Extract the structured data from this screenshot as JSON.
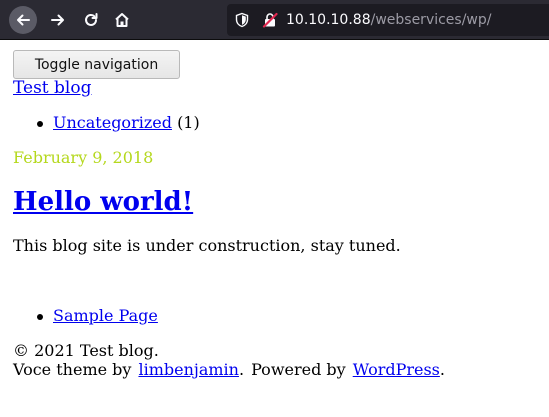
{
  "browser": {
    "url_host": "10.10.10.88",
    "url_path": "/webservices/wp/"
  },
  "page": {
    "toggle_label": "Toggle navigation",
    "site_title": "Test blog",
    "categories": [
      {
        "label": "Uncategorized",
        "count": "(1)"
      }
    ],
    "post": {
      "date": "February 9, 2018",
      "title": "Hello world!",
      "body": "This blog site is under construction, stay tuned."
    },
    "pages": [
      {
        "label": "Sample Page"
      }
    ],
    "footer": {
      "copyright": "© 2021 Test blog.",
      "theme_prefix": "Voce theme by",
      "theme_author": "limbenjamin",
      "powered_prefix": "Powered by",
      "powered_link": "WordPress",
      "end_period": "."
    }
  },
  "colors": {
    "chrome_bg": "#2b2a33",
    "urlbar_bg": "#1c1b22",
    "date_color": "#b5d81e",
    "link_color": "#0000ee"
  }
}
